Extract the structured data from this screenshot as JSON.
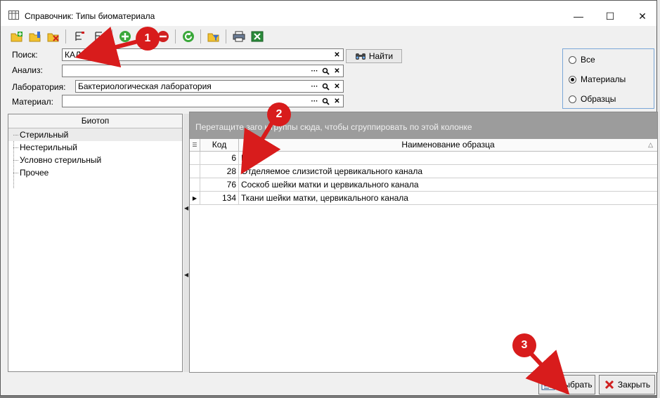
{
  "window": {
    "title": "Справочник: Типы биоматериала",
    "controls": {
      "minimize": "—",
      "maximize": "☐",
      "close": "✕"
    }
  },
  "toolbar": {
    "icons": [
      "add-folder-icon",
      "edit-folder-icon",
      "delete-folder-icon",
      "filter-icon",
      "clear-filter-icon",
      "add-icon",
      "remove-icon",
      "refresh-icon",
      "folder-filter-icon",
      "print-icon",
      "excel-icon"
    ]
  },
  "form": {
    "search": {
      "label": "Поиск:",
      "value": "КАЛ"
    },
    "analysis": {
      "label": "Анализ:",
      "value": ""
    },
    "laboratory": {
      "label": "Лаборатория:",
      "value": "Бактериологическая лаборатория"
    },
    "material": {
      "label": "Материал:",
      "value": ""
    },
    "find_button": "Найти"
  },
  "radio": {
    "options": [
      {
        "label": "Все",
        "selected": false
      },
      {
        "label": "Материалы",
        "selected": true
      },
      {
        "label": "Образцы",
        "selected": false
      }
    ]
  },
  "tree": {
    "header": "Биотоп",
    "items": [
      "Стерильный",
      "Нестерильный",
      "Условно стерильный",
      "Прочее"
    ]
  },
  "grid": {
    "group_hint": "Перетащите заго     к группы сюда, чтобы сгруппировать по этой колонке",
    "columns": {
      "code": "Код",
      "name": "Наименование образца"
    },
    "rows": [
      {
        "code": "6",
        "name": "Кал"
      },
      {
        "code": "28",
        "name": "Отделяемое слизистой цервикального канала"
      },
      {
        "code": "76",
        "name": "Соскоб шейки матки и цервикального канала"
      },
      {
        "code": "134",
        "name": "Ткани шейки матки, цервикального канала"
      }
    ]
  },
  "buttons": {
    "select": "Выбрать",
    "close": "Закрыть"
  },
  "annotations": {
    "b1": "1",
    "b2": "2",
    "b3": "3",
    "color": "#d81c1c"
  }
}
